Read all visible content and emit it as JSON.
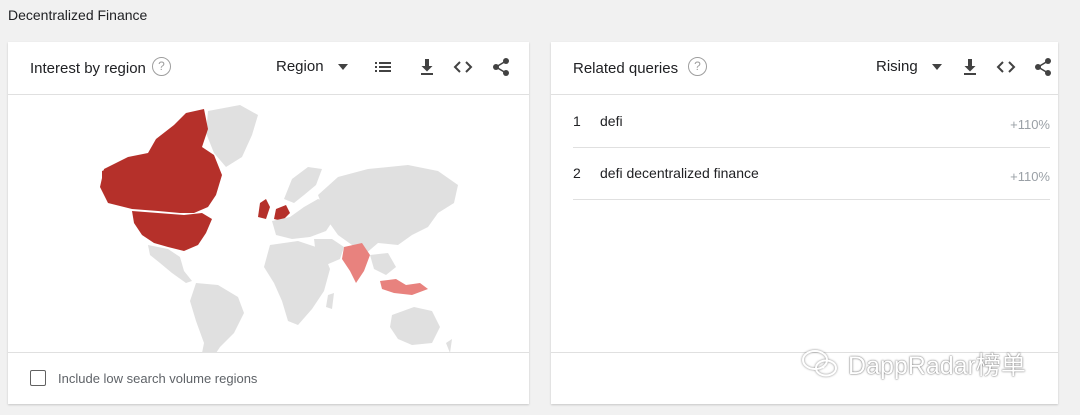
{
  "page": {
    "title": "Decentralized Finance"
  },
  "region_card": {
    "title": "Interest by region",
    "help": "?",
    "dropdown_label": "Region",
    "checkbox_label": "Include low search volume regions",
    "checkbox_checked": false,
    "highlight_color": "#b5302a",
    "light_highlight_color": "#e8827e",
    "base_color": "#e0e0e0",
    "highlighted_regions": [
      "Canada",
      "United States",
      "United Kingdom",
      "Netherlands",
      "India",
      "Indonesia"
    ]
  },
  "queries_card": {
    "title": "Related queries",
    "help": "?",
    "dropdown_label": "Rising",
    "rows": [
      {
        "rank": "1",
        "query": "defi",
        "value": "+110%"
      },
      {
        "rank": "2",
        "query": "defi decentralized finance",
        "value": "+110%"
      }
    ]
  },
  "toolbar_icons": [
    "list-icon",
    "download-icon",
    "embed-icon",
    "share-icon"
  ],
  "watermark": {
    "text": "DappRadar榜单",
    "icon": "wechat-icon"
  }
}
